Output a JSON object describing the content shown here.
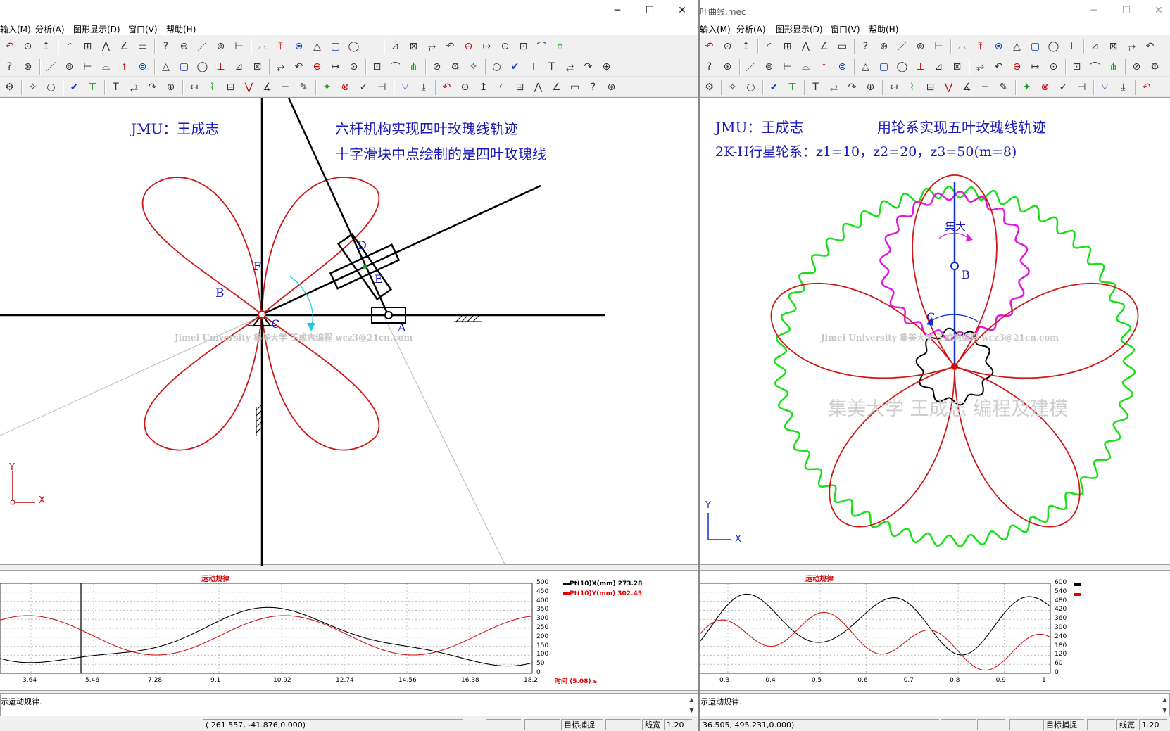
{
  "left": {
    "window_title": "",
    "menu": [
      "输入(M)",
      "分析(A)",
      "图形显示(D)",
      "窗口(V)",
      "帮助(H)"
    ],
    "canvas": {
      "title_author": "JMU：王成志",
      "title_main": "六杆机构实现四叶玫瑰线轨迹",
      "title_sub": "十字滑块中点绘制的是四叶玫瑰线",
      "watermark": "Jimei University 集美大学 王成志编程  wcz3@21cn.com",
      "point_labels": [
        "B",
        "F",
        "C",
        "D",
        "E",
        "A"
      ],
      "axis_y": "Y",
      "axis_x": "X"
    },
    "plot": {
      "title": "运动规律",
      "x_ticks": [
        "3.64",
        "5.46",
        "7.28",
        "9.1",
        "10.92",
        "12.74",
        "14.56",
        "16.38",
        "18.2"
      ],
      "y_ticks": [
        "500",
        "450",
        "400",
        "350",
        "300",
        "250",
        "200",
        "150",
        "100",
        "50",
        "0"
      ],
      "legend": [
        {
          "label": "Pt(10)X(mm)",
          "value": "273.28",
          "color": "#000000"
        },
        {
          "label": "Pt(10)Y(mm)",
          "value": "302.45",
          "color": "#e00000"
        }
      ],
      "time_label": "时间 (5.08) s"
    },
    "message": "示运动规律.",
    "status": {
      "coords": "(    261.557,    -41.876,0.000)",
      "snap": "目标捕捉",
      "linewidth_label": "线宽",
      "linewidth": "1.20"
    }
  },
  "right": {
    "window_title": "叶曲线.mec",
    "menu": [
      "输入(M)",
      "分析(A)",
      "图形显示(D)",
      "窗口(V)",
      "帮助(H)"
    ],
    "canvas": {
      "title_author": "JMU：王成志",
      "title_main": "用轮系实现五叶玫瑰线轨迹",
      "title_sub": "2K-H行星轮系：z1=10，z2=20，z3=50(m=8)",
      "watermark": "Jimei University 集美大学 王成志编程  wcz3@21cn.com",
      "big_watermark": "集美大学   王成志  编程及建模",
      "point_labels": [
        "B",
        "C"
      ],
      "arrow_label": "集大",
      "axis_y": "Y",
      "axis_x": "X"
    },
    "plot": {
      "title": "运动规律",
      "x_ticks": [
        "0.3",
        "0.4",
        "0.5",
        "0.6",
        "0.7",
        "0.8",
        "0.9",
        "1"
      ],
      "y_ticks": [
        "600",
        "540",
        "480",
        "420",
        "360",
        "300",
        "240",
        "180",
        "120",
        "60",
        "0"
      ]
    },
    "message": "示运动规律.",
    "status": {
      "coords": "36.505,    495.231,0.000)",
      "snap": "目标捕捉",
      "linewidth_label": "线宽",
      "linewidth": "1.20"
    }
  },
  "colors": {
    "rose": "#d01818",
    "blue_text": "#1a1ab8",
    "gear_green": "#18e018",
    "gear_magenta": "#e018e0",
    "link_blue": "#1030d0"
  }
}
